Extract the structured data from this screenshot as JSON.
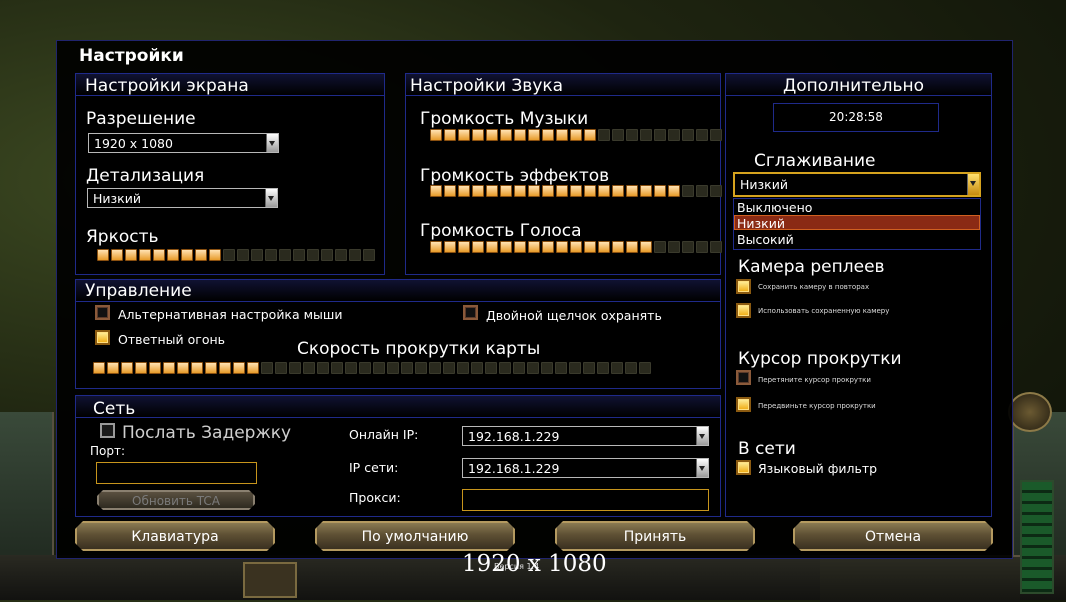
{
  "title": "Настройки",
  "screen": {
    "heading": "Настройки экрана",
    "resolution_label": "Разрешение",
    "resolution_value": "1920 x 1080",
    "detail_label": "Детализация",
    "detail_value": "Низкий",
    "brightness_label": "Яркость",
    "brightness_level": 9,
    "brightness_segments": 20
  },
  "sound": {
    "heading": "Настройки Звука",
    "music_label": "Громкость Музыки",
    "music_level": 12,
    "effects_label": "Громкость эффектов",
    "effects_level": 18,
    "voice_label": "Громкость Голоса",
    "voice_level": 16,
    "segments": 21
  },
  "control": {
    "heading": "Управление",
    "alt_mouse_label": "Альтернативная настройка мыши",
    "alt_mouse_checked": false,
    "double_click_label": "Двойной щелчок охранять",
    "double_click_checked": false,
    "return_fire_label": "Ответный огонь",
    "return_fire_checked": true,
    "scroll_speed_label": "Скорость прокрутки карты",
    "scroll_speed_level": 12,
    "scroll_speed_segments": 40
  },
  "network": {
    "heading": "Сеть",
    "send_delay_label": "Послать Задержку",
    "send_delay_checked": false,
    "port_label": "Порт:",
    "port_value": "",
    "update_tca_label": "Обновить TCA",
    "online_ip_label": "Онлайн IP:",
    "online_ip_value": "192.168.1.229",
    "lan_ip_label": "IP сети:",
    "lan_ip_value": "192.168.1.229",
    "proxy_label": "Прокси:",
    "proxy_value": ""
  },
  "extra": {
    "heading": "Дополнительно",
    "clock": "20:28:58",
    "aa_label": "Сглаживание",
    "aa_value": "Низкий",
    "aa_options": [
      "Выключено",
      "Низкий",
      "Высокий"
    ],
    "aa_selected_index": 1,
    "replay_cam_label": "Камера реплеев",
    "replay_save_label": "Сохранить камеру в повторах",
    "replay_save_checked": true,
    "replay_use_label": "Использовать сохраненную камеру",
    "replay_use_checked": true,
    "scroll_cursor_label": "Курсор прокрутки",
    "cursor_drag_label": "Перетяните курсор прокрутки",
    "cursor_drag_checked": false,
    "cursor_move_label": "Передвиньте курсор прокрутки",
    "cursor_move_checked": true,
    "online_label": "В сети",
    "lang_filter_label": "Языковый фильтр",
    "lang_filter_checked": true
  },
  "buttons": {
    "keyboard": "Клавиатура",
    "defaults": "По умолчанию",
    "accept": "Принять",
    "cancel": "Отмена"
  },
  "overlay_resolution": "1920 x 1080",
  "version": "Версия 1.4"
}
